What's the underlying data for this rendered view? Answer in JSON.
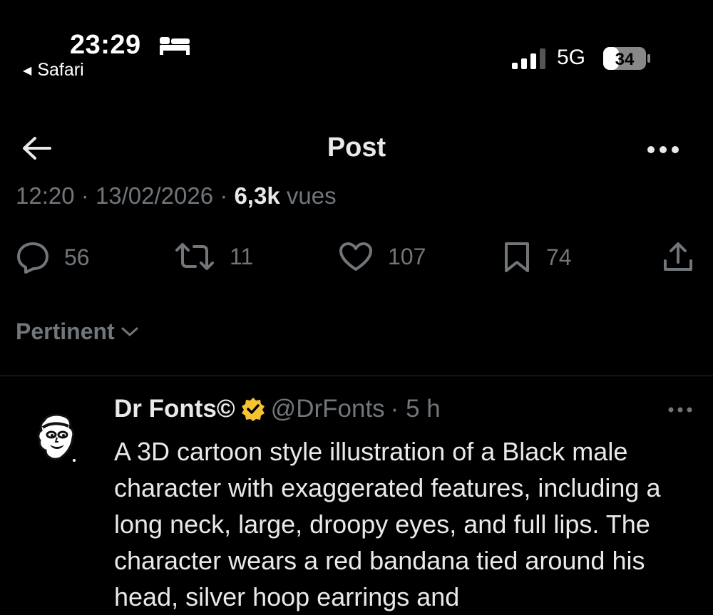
{
  "status_bar": {
    "time": "23:29",
    "back_app": "Safari",
    "network": "5G",
    "battery": "34"
  },
  "header": {
    "title": "Post"
  },
  "meta": {
    "time": "12:20",
    "date": "13/02/2026",
    "views_count": "6,3k",
    "views_label": "vues"
  },
  "actions": {
    "replies": "56",
    "reposts": "11",
    "likes": "107",
    "bookmarks": "74"
  },
  "sort": {
    "label": "Pertinent"
  },
  "reply": {
    "author": "Dr Fonts©",
    "handle": "@DrFonts",
    "time": "5 h",
    "text": "A 3D cartoon style illustration of a Black male character with exaggerated features, including a long neck, large, droopy eyes, and full lips. The character wears a red bandana tied around his head, silver hoop earrings and"
  },
  "colors": {
    "background": "#000000",
    "text": "#e7e9ea",
    "muted": "#71767b",
    "divider": "#2f3336",
    "verified": "#f4c430"
  },
  "icons": [
    "sleep-icon",
    "signal-icon",
    "battery-icon",
    "back-arrow-icon",
    "more-icon",
    "reply-icon",
    "repost-icon",
    "like-icon",
    "bookmark-icon",
    "share-icon",
    "chevron-down-icon",
    "verified-badge-icon"
  ]
}
